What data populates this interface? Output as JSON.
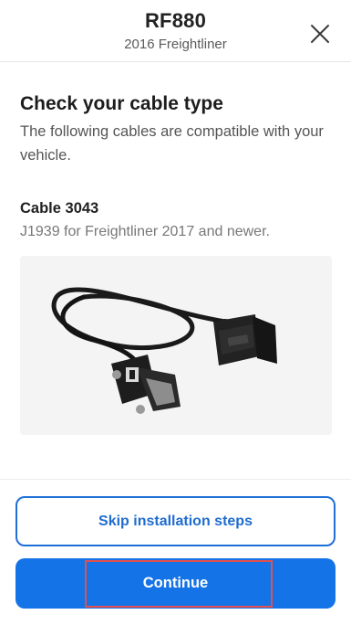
{
  "header": {
    "title": "RF880",
    "subtitle": "2016 Freightliner",
    "close_icon": "close-icon"
  },
  "main": {
    "heading": "Check your cable type",
    "description": "The following cables are compatible with your vehicle.",
    "cable": {
      "name": "Cable 3043",
      "description": "J1939 for Freightliner 2017 and newer.",
      "image_icon": "obd-cable-image"
    }
  },
  "footer": {
    "skip_label": "Skip installation steps",
    "continue_label": "Continue"
  },
  "colors": {
    "primary": "#1473e6",
    "primary_border": "#1f70d6",
    "highlight": "#e0514f",
    "image_bg": "#f4f4f4"
  }
}
